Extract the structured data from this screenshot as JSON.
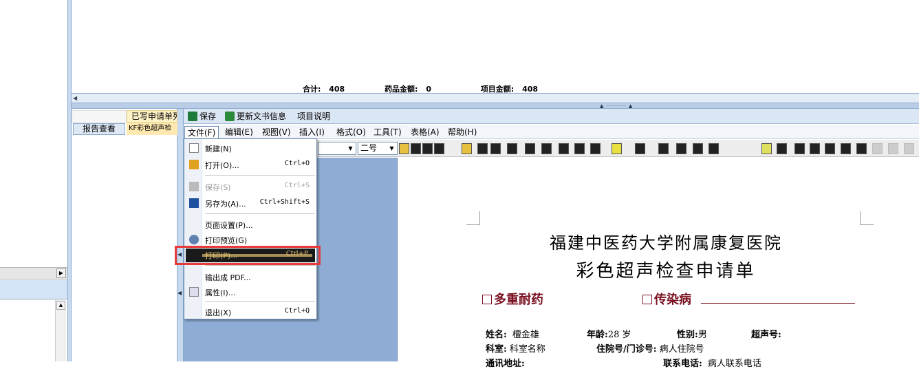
{
  "summary": {
    "total_label": "合计:",
    "total_value": "408",
    "drug_label": "药品金额:",
    "drug_value": "0",
    "item_label": "项目金额:",
    "item_value": "408"
  },
  "records": {
    "header_tab": "已写申请单列",
    "report_button": "报告查看",
    "record_name": "KF彩色超声检"
  },
  "toolbar": {
    "save": "保存",
    "update_doc": "更新文书信息",
    "item_desc": "项目说明"
  },
  "menubar": {
    "file": "文件(F)",
    "edit": "编辑(E)",
    "view": "视图(V)",
    "insert": "插入(I)",
    "format": "格式(O)",
    "tools": "工具(T)",
    "table": "表格(A)",
    "help": "帮助(H)"
  },
  "format_bar": {
    "font_size": "二号"
  },
  "file_menu": {
    "new_label": "新建(N)",
    "open_label": "打开(O)...",
    "open_shortcut": "Ctrl+O",
    "save_label": "保存(S)",
    "save_shortcut": "Ctrl+S",
    "save_as_label": "另存为(A)...",
    "save_as_shortcut": "Ctrl+Shift+S",
    "page_setup_label": "页面设置(P)...",
    "print_preview_label": "打印预览(G)",
    "print_label": "打印(P)...",
    "print_shortcut": "Ctrl+P",
    "export_pdf_label": "输出成 PDF...",
    "properties_label": "属性(I)...",
    "exit_label": "退出(X)",
    "exit_shortcut": "Ctrl+Q"
  },
  "document": {
    "hospital": "福建中医药大学附属康复医院",
    "form_title": "彩色超声检查申请单",
    "mdro_label": "多重耐药",
    "infectious_label": "传染病",
    "name_label": "姓名:",
    "name_value": "檀金雄",
    "age_label": "年龄:",
    "age_value": "28 岁",
    "sex_label": "性别:",
    "sex_value": "男",
    "ultra_no_label": "超声号:",
    "dept_label": "科室:",
    "dept_value": "科室名称",
    "inpatient_label": "住院号/门诊号:",
    "inpatient_value": "病人住院号",
    "address_label": "通讯地址:",
    "phone_label": "联系电话:",
    "phone_value": "病人联系电话"
  },
  "colors": {
    "accent_red": "#7a1020",
    "highlight": "#e83a3a",
    "toolbar_bg": "#dbe6f4",
    "canvas_bg": "#8eacd4"
  }
}
